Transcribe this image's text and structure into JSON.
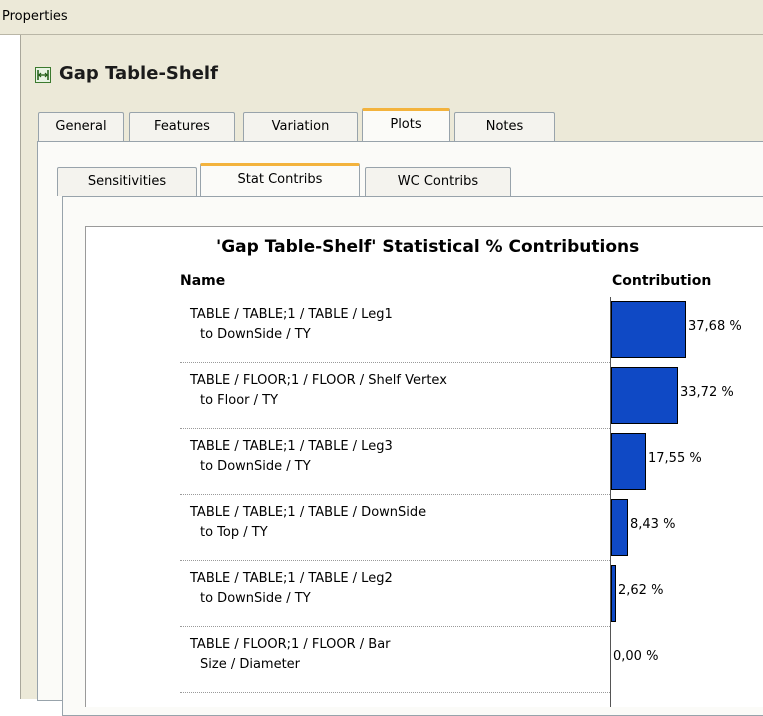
{
  "window": {
    "title": "Properties"
  },
  "header": {
    "title": "Gap Table-Shelf",
    "icon": "gap-dimension-icon"
  },
  "tabs": [
    {
      "label": "General",
      "active": false
    },
    {
      "label": "Features",
      "active": false
    },
    {
      "label": "Variation",
      "active": false
    },
    {
      "label": "Plots",
      "active": true
    },
    {
      "label": "Notes",
      "active": false
    }
  ],
  "subtabs": [
    {
      "label": "Sensitivities",
      "active": false
    },
    {
      "label": "Stat Contribs",
      "active": true
    },
    {
      "label": "WC Contribs",
      "active": false
    }
  ],
  "colors": {
    "bar": "#0f49c5",
    "active_tab_accent": "#f3b33d"
  },
  "chart_data": {
    "type": "bar",
    "title": "'Gap Table-Shelf' Statistical % Contributions",
    "columns": {
      "name": "Name",
      "contribution": "Contribution"
    },
    "rows": [
      {
        "line1": "TABLE / TABLE;1 / TABLE / Leg1",
        "line2": "to DownSide / TY",
        "value": 37.68,
        "label": "37,68 %"
      },
      {
        "line1": "TABLE / FLOOR;1 / FLOOR / Shelf Vertex",
        "line2": "to Floor / TY",
        "value": 33.72,
        "label": "33,72 %"
      },
      {
        "line1": "TABLE / TABLE;1 / TABLE / Leg3",
        "line2": "to DownSide / TY",
        "value": 17.55,
        "label": "17,55 %"
      },
      {
        "line1": "TABLE / TABLE;1 / TABLE / DownSide",
        "line2": "to Top / TY",
        "value": 8.43,
        "label": "8,43 %"
      },
      {
        "line1": "TABLE / TABLE;1 / TABLE / Leg2",
        "line2": "to DownSide / TY",
        "value": 2.62,
        "label": "2,62 %"
      },
      {
        "line1": "TABLE / FLOOR;1 / FLOOR / Bar",
        "line2": "Size / Diameter",
        "value": 0.0,
        "label": "0,00 %"
      }
    ]
  }
}
